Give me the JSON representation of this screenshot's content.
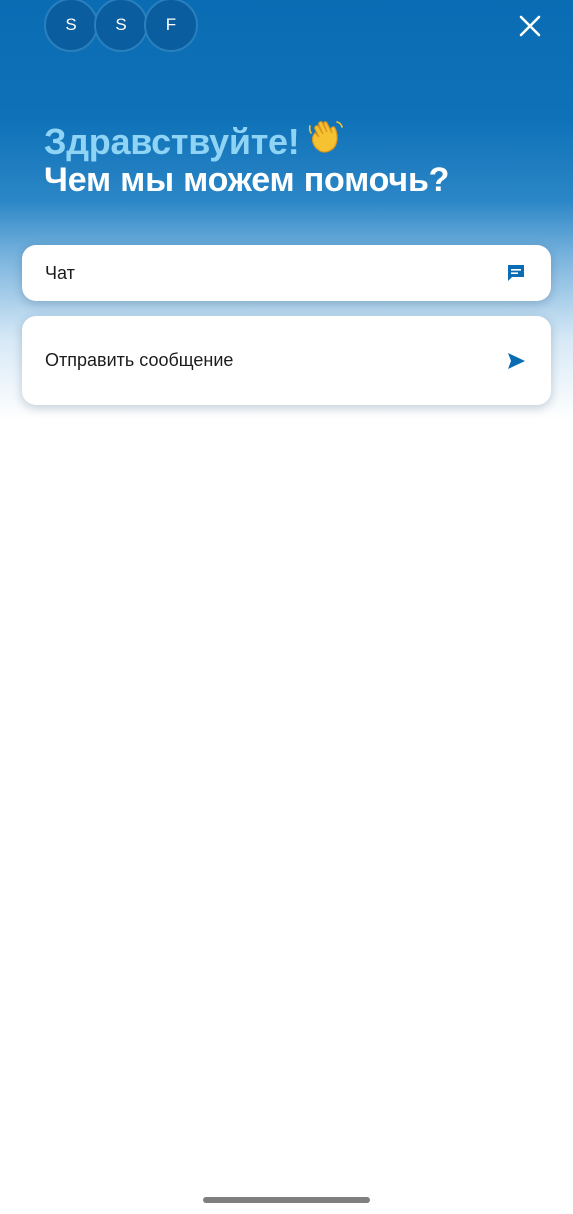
{
  "header": {
    "avatars": [
      {
        "initial": "S"
      },
      {
        "initial": "S"
      },
      {
        "initial": "F"
      }
    ],
    "close_icon": "close-icon"
  },
  "hero": {
    "greeting": "Здравствуйте!",
    "greeting_emoji": "waving-hand-icon",
    "subtitle": "Чем мы можем помочь?"
  },
  "options": {
    "chat": {
      "label": "Чат",
      "icon": "chat-bubble-icon"
    },
    "message": {
      "label": "Отправить сообщение",
      "icon": "send-icon"
    }
  },
  "colors": {
    "brand_blue": "#0a6cb3",
    "greeting_color": "#8fd3f5",
    "icon_color": "#0a6cb3"
  }
}
